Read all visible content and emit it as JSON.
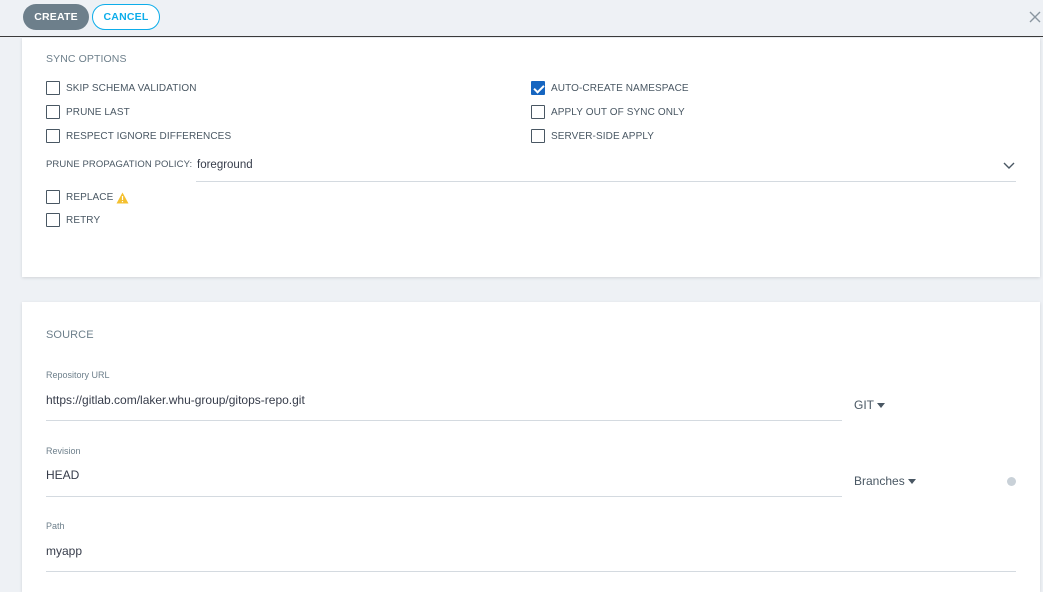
{
  "toolbar": {
    "create_label": "CREATE",
    "cancel_label": "CANCEL"
  },
  "sync_options": {
    "title": "SYNC OPTIONS",
    "checkboxes": [
      {
        "label": "SKIP SCHEMA VALIDATION",
        "checked": false
      },
      {
        "label": "PRUNE LAST",
        "checked": false
      },
      {
        "label": "RESPECT IGNORE DIFFERENCES",
        "checked": false
      },
      {
        "label": "AUTO-CREATE NAMESPACE",
        "checked": true
      },
      {
        "label": "APPLY OUT OF SYNC ONLY",
        "checked": false
      },
      {
        "label": "SERVER-SIDE APPLY",
        "checked": false
      }
    ],
    "prune_policy_label": "PRUNE PROPAGATION POLICY:",
    "prune_policy_value": "foreground",
    "replace_label": "REPLACE",
    "retry_label": "RETRY"
  },
  "source": {
    "title": "SOURCE",
    "repo_url_label": "Repository URL",
    "repo_url_value": "https://gitlab.com/laker.whu-group/gitops-repo.git",
    "repo_type": "GIT",
    "revision_label": "Revision",
    "revision_value": "HEAD",
    "revision_type": "Branches",
    "path_label": "Path",
    "path_value": "myapp"
  },
  "colors": {
    "accent": "#0dadea",
    "checkbox_checked": "#1565c0",
    "warning": "#f4c030"
  }
}
